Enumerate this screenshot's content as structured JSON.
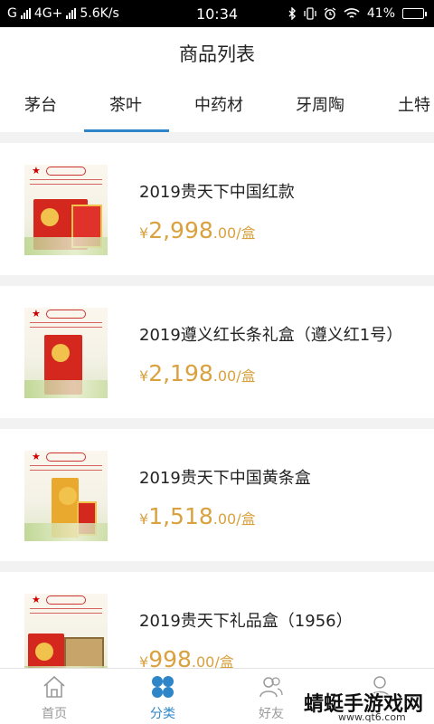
{
  "status_bar": {
    "carrier_left": "G",
    "network": "4G+",
    "speed": "5.6K/s",
    "time": "10:34",
    "battery_percent": "41%",
    "battery_level": 0.41,
    "icons": [
      "signal-icon",
      "bluetooth-icon",
      "vibrate-icon",
      "alarm-icon",
      "wifi-icon",
      "battery-icon"
    ]
  },
  "header": {
    "title": "商品列表"
  },
  "tabs": [
    {
      "label": "茅台"
    },
    {
      "label": "茶叶",
      "active": true
    },
    {
      "label": "中药材"
    },
    {
      "label": "牙周陶"
    },
    {
      "label": "土特"
    }
  ],
  "products": [
    {
      "title": "2019贵天下中国红款",
      "currency": "¥",
      "amount": "2,998",
      "decimal_unit": ".00/盒"
    },
    {
      "title": "2019遵义红长条礼盒（遵义红1号）",
      "currency": "¥",
      "amount": "2,198",
      "decimal_unit": ".00/盒"
    },
    {
      "title": "2019贵天下中国黄条盒",
      "currency": "¥",
      "amount": "1,518",
      "decimal_unit": ".00/盒"
    },
    {
      "title": "2019贵天下礼品盒（1956）",
      "currency": "¥",
      "amount": "998",
      "decimal_unit": ".00/盒"
    }
  ],
  "bottom_nav": [
    {
      "label": "首页",
      "icon": "home-icon"
    },
    {
      "label": "分类",
      "icon": "category-icon",
      "active": true
    },
    {
      "label": "好友",
      "icon": "friends-icon"
    },
    {
      "label": "",
      "icon": "profile-icon"
    }
  ],
  "watermark": {
    "main": "蜻蜓手游戏网",
    "sub": "www.qt6.com"
  },
  "colors": {
    "accent": "#2e86c8",
    "price": "#d9a13f",
    "background": "#f2f2f2"
  }
}
